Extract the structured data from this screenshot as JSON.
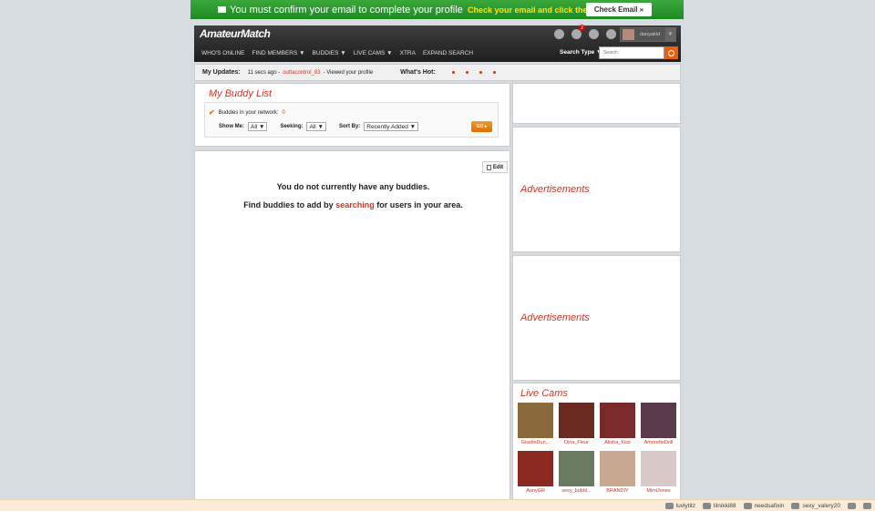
{
  "confirm_bar": {
    "message": "You must confirm your email to complete your profile",
    "cta": "Check your email and click the link",
    "button": "Check Email »"
  },
  "header": {
    "logo": "AmateurMatch",
    "nav": [
      "WHO'S ONLINE",
      "FIND MEMBERS ▼",
      "BUDDIES ▼",
      "LIVE CAMS ▼",
      "XTRA",
      "EXPAND SEARCH"
    ],
    "message_badge": "2",
    "username": "danyakid",
    "search_type_label": "Search Type ▼",
    "search_placeholder": "Search"
  },
  "updates": {
    "label": "My Updates:",
    "time": "11 secs ago -",
    "user": "outtacontrol_83",
    "action": "- Viewed your profile",
    "hot_label": "What's Hot:"
  },
  "buddy_list": {
    "title": "My Buddy List",
    "network_label": "Buddies in your network:",
    "network_count": "0",
    "show_me_label": "Show Me:",
    "show_me_value": "All ▼",
    "seeking_label": "Seeking:",
    "seeking_value": "All ▼",
    "sort_label": "Sort By:",
    "sort_value": "Recently Added ▼",
    "go_button": "GO ▸"
  },
  "main": {
    "edit_button": "Edit",
    "empty_message": "You do not currently have any buddies.",
    "find_prefix": "Find buddies to add by",
    "find_link": "searching",
    "find_suffix": "for users in your area."
  },
  "sidebar": {
    "ad_label_1": "Advertisements",
    "ad_label_2": "Advertisements",
    "cams_title": "Live Cams",
    "cams": [
      {
        "name": "GiselleDun...",
        "color": "#8a6a3a"
      },
      {
        "name": "Dina_Fleur",
        "color": "#6b2a20"
      },
      {
        "name": "Alisha_Kiss",
        "color": "#7a2a2a"
      },
      {
        "name": "AmoretteDoll",
        "color": "#5a3a4a"
      },
      {
        "name": "AnnyGill",
        "color": "#8a2a20"
      },
      {
        "name": "sexy_bubbl...",
        "color": "#6a7a60"
      },
      {
        "name": "BRANDIY",
        "color": "#c8a890"
      },
      {
        "name": "MimiJones",
        "color": "#d8c8c8"
      }
    ]
  },
  "chat_bar": {
    "users": [
      "luvlytitz",
      "lilnikki88",
      "needsafixin",
      "sexy_valery20"
    ]
  }
}
